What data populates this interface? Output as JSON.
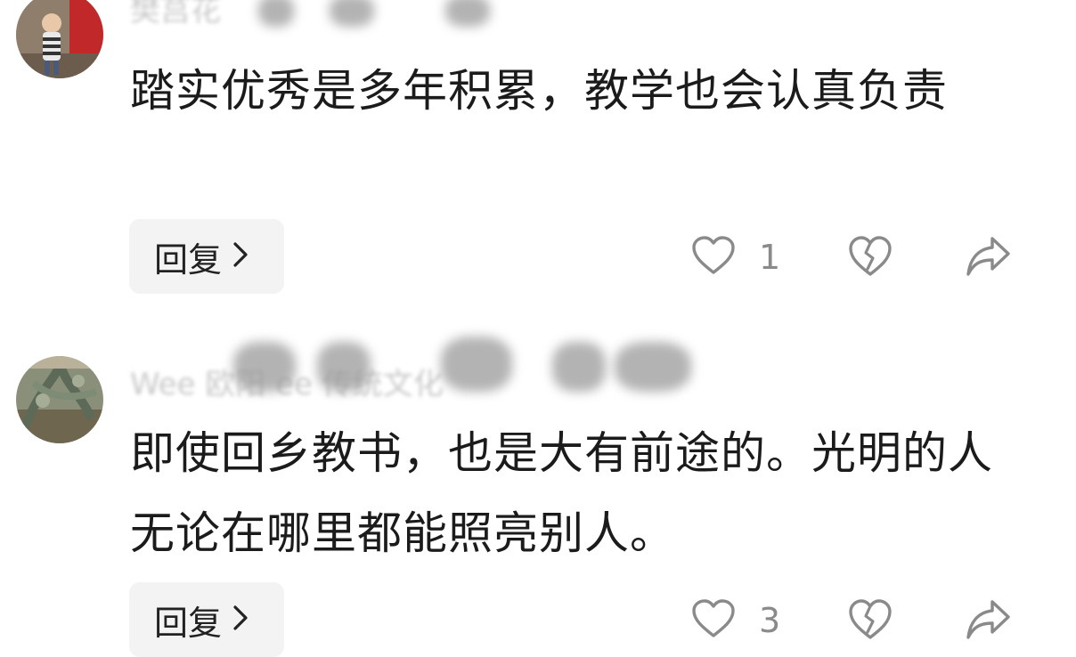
{
  "comments": [
    {
      "username": "樊莒花",
      "text": "踏实优秀是多年积累，教学也会认真负责",
      "reply_label": "回复",
      "like_count": "1"
    },
    {
      "username": "Wee 欧阳 ee 传统文化",
      "text": "即使回乡教书，也是大有前途的。光明的人无论在哪里都能照亮别人。",
      "reply_label": "回复",
      "like_count": "3"
    }
  ],
  "icons": {
    "like": "heart-icon",
    "dislike": "broken-heart-icon",
    "share": "share-arrow-icon",
    "reply_chevron": "chevron-right-icon"
  },
  "colors": {
    "reply_bg": "#f3f3f3",
    "icon_gray": "#8a8a8a",
    "text": "#1b1b1b"
  }
}
